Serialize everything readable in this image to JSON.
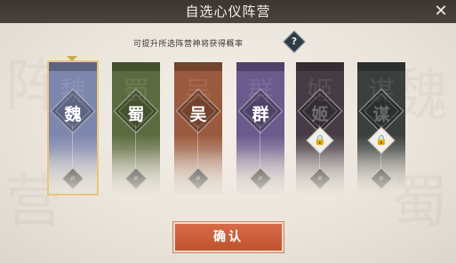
{
  "header": {
    "title": "自选心仪阵营",
    "close_glyph": "✕"
  },
  "subtitle": "可提升所选阵营神将获得概率",
  "help_glyph": "?",
  "factions": [
    {
      "label": "魏",
      "locked": false,
      "selected": true,
      "color": "#7d86ad"
    },
    {
      "label": "蜀",
      "locked": false,
      "selected": false,
      "color": "#5c6b3f"
    },
    {
      "label": "吴",
      "locked": false,
      "selected": false,
      "color": "#9a5a3e"
    },
    {
      "label": "群",
      "locked": false,
      "selected": false,
      "color": "#6b5a8c"
    },
    {
      "label": "姬",
      "locked": true,
      "selected": false,
      "color": "#463c45"
    },
    {
      "label": "谋",
      "locked": true,
      "selected": false,
      "color": "#3a403d"
    }
  ],
  "confirm_label": "确认",
  "watermark": [
    "阵",
    "营",
    "魏",
    "蜀"
  ]
}
